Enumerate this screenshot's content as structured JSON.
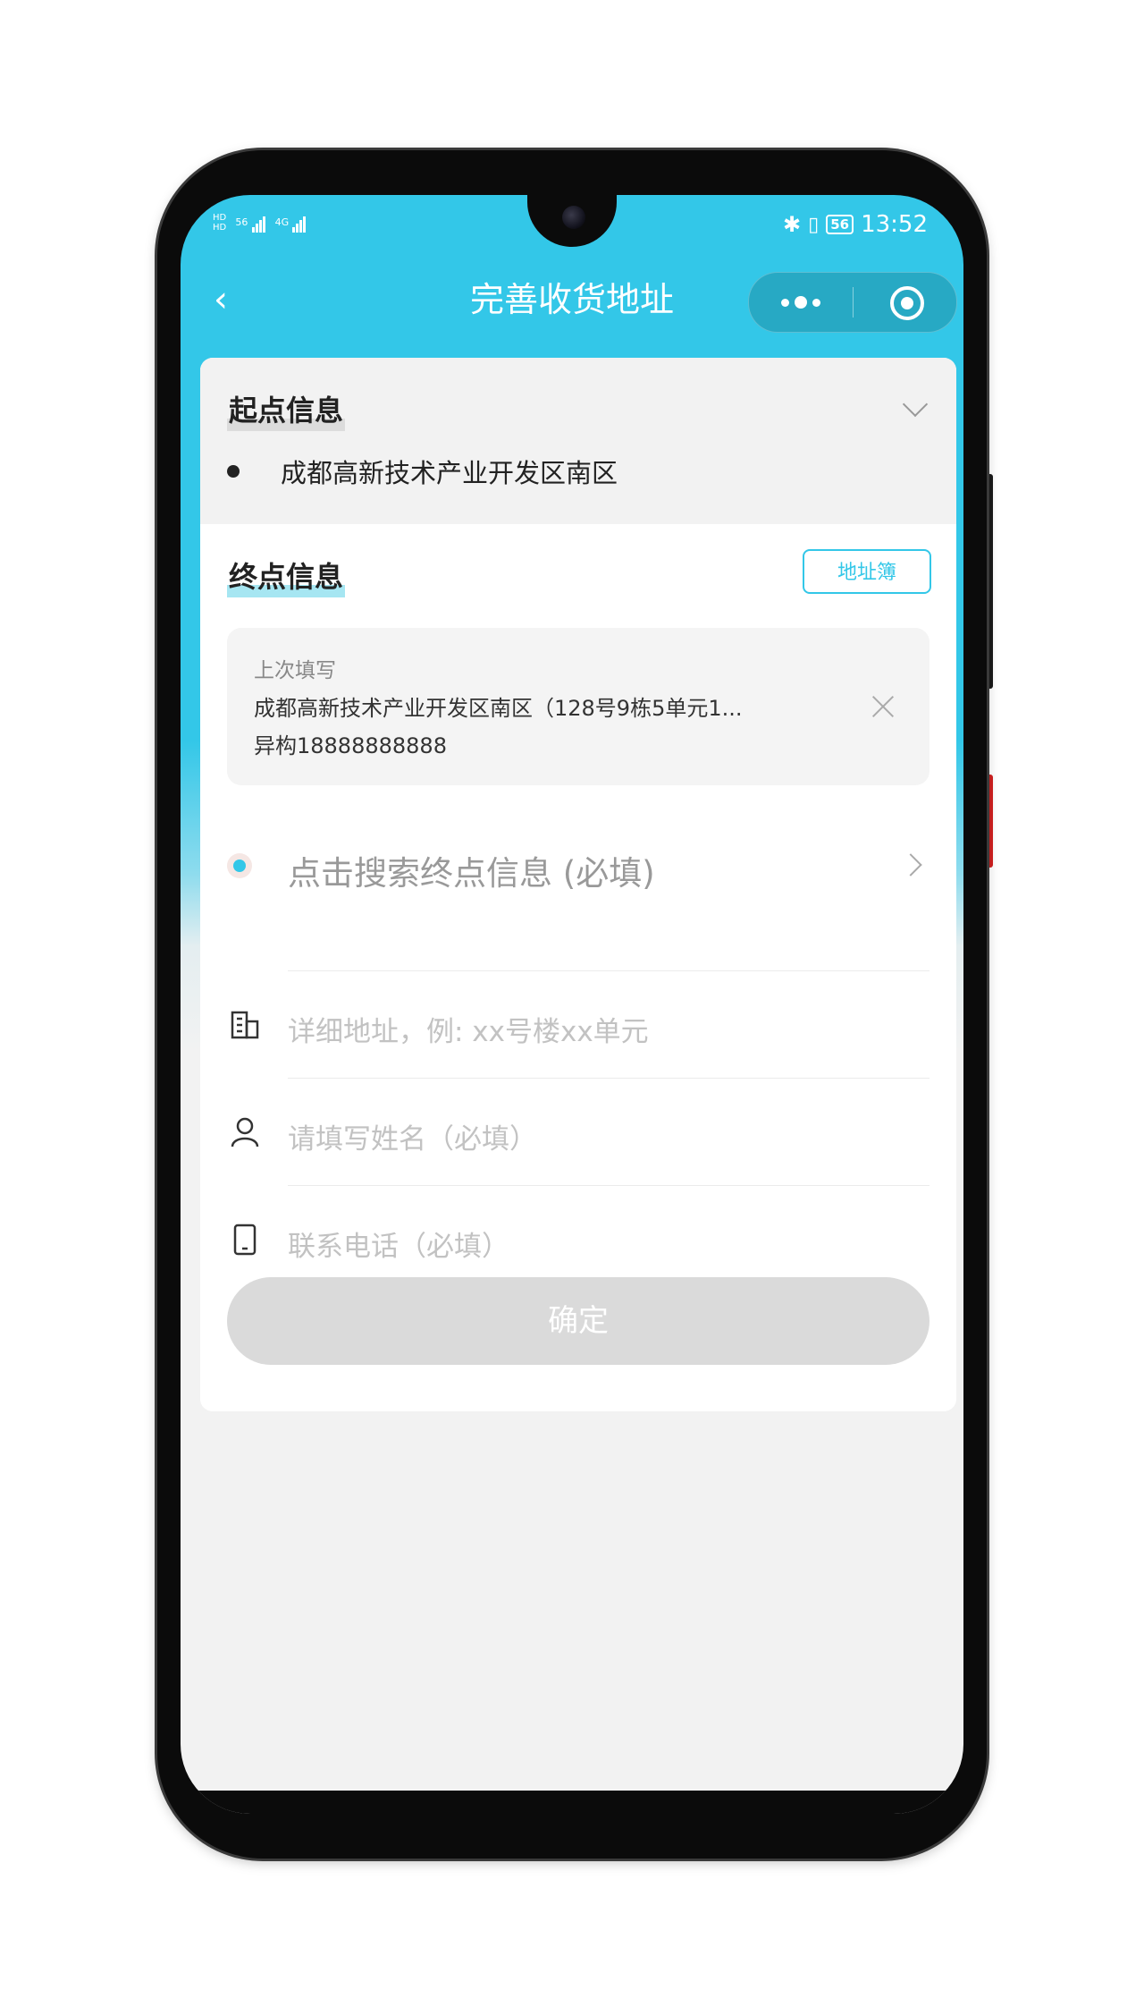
{
  "status_bar": {
    "left_sim": "56",
    "left_net": "4G",
    "battery": "56",
    "time": "13:52"
  },
  "navbar": {
    "back_icon": "chevron-left-icon",
    "title": "完善收货地址",
    "more_icon": "more-dots-icon",
    "close_icon": "target-circle-icon"
  },
  "start": {
    "title": "起点信息",
    "address": "成都高新技术产业开发区南区"
  },
  "end": {
    "title": "终点信息",
    "address_book_button": "地址簿",
    "last_filled": {
      "label": "上次填写",
      "line1": "成都高新技术产业开发区南区（128号9栋5单元1...",
      "line2": "异构18888888888"
    },
    "search_placeholder": "点击搜索终点信息 (必填)",
    "fields": {
      "detail_placeholder": "详细地址，例: xx号楼xx单元",
      "name_placeholder": "请填写姓名（必填）",
      "phone_placeholder": "联系电话（必填）"
    },
    "confirm_button": "确定"
  },
  "colors": {
    "accent": "#33c7e8",
    "button_disabled": "#dadada",
    "background": "#f2f2f2"
  }
}
